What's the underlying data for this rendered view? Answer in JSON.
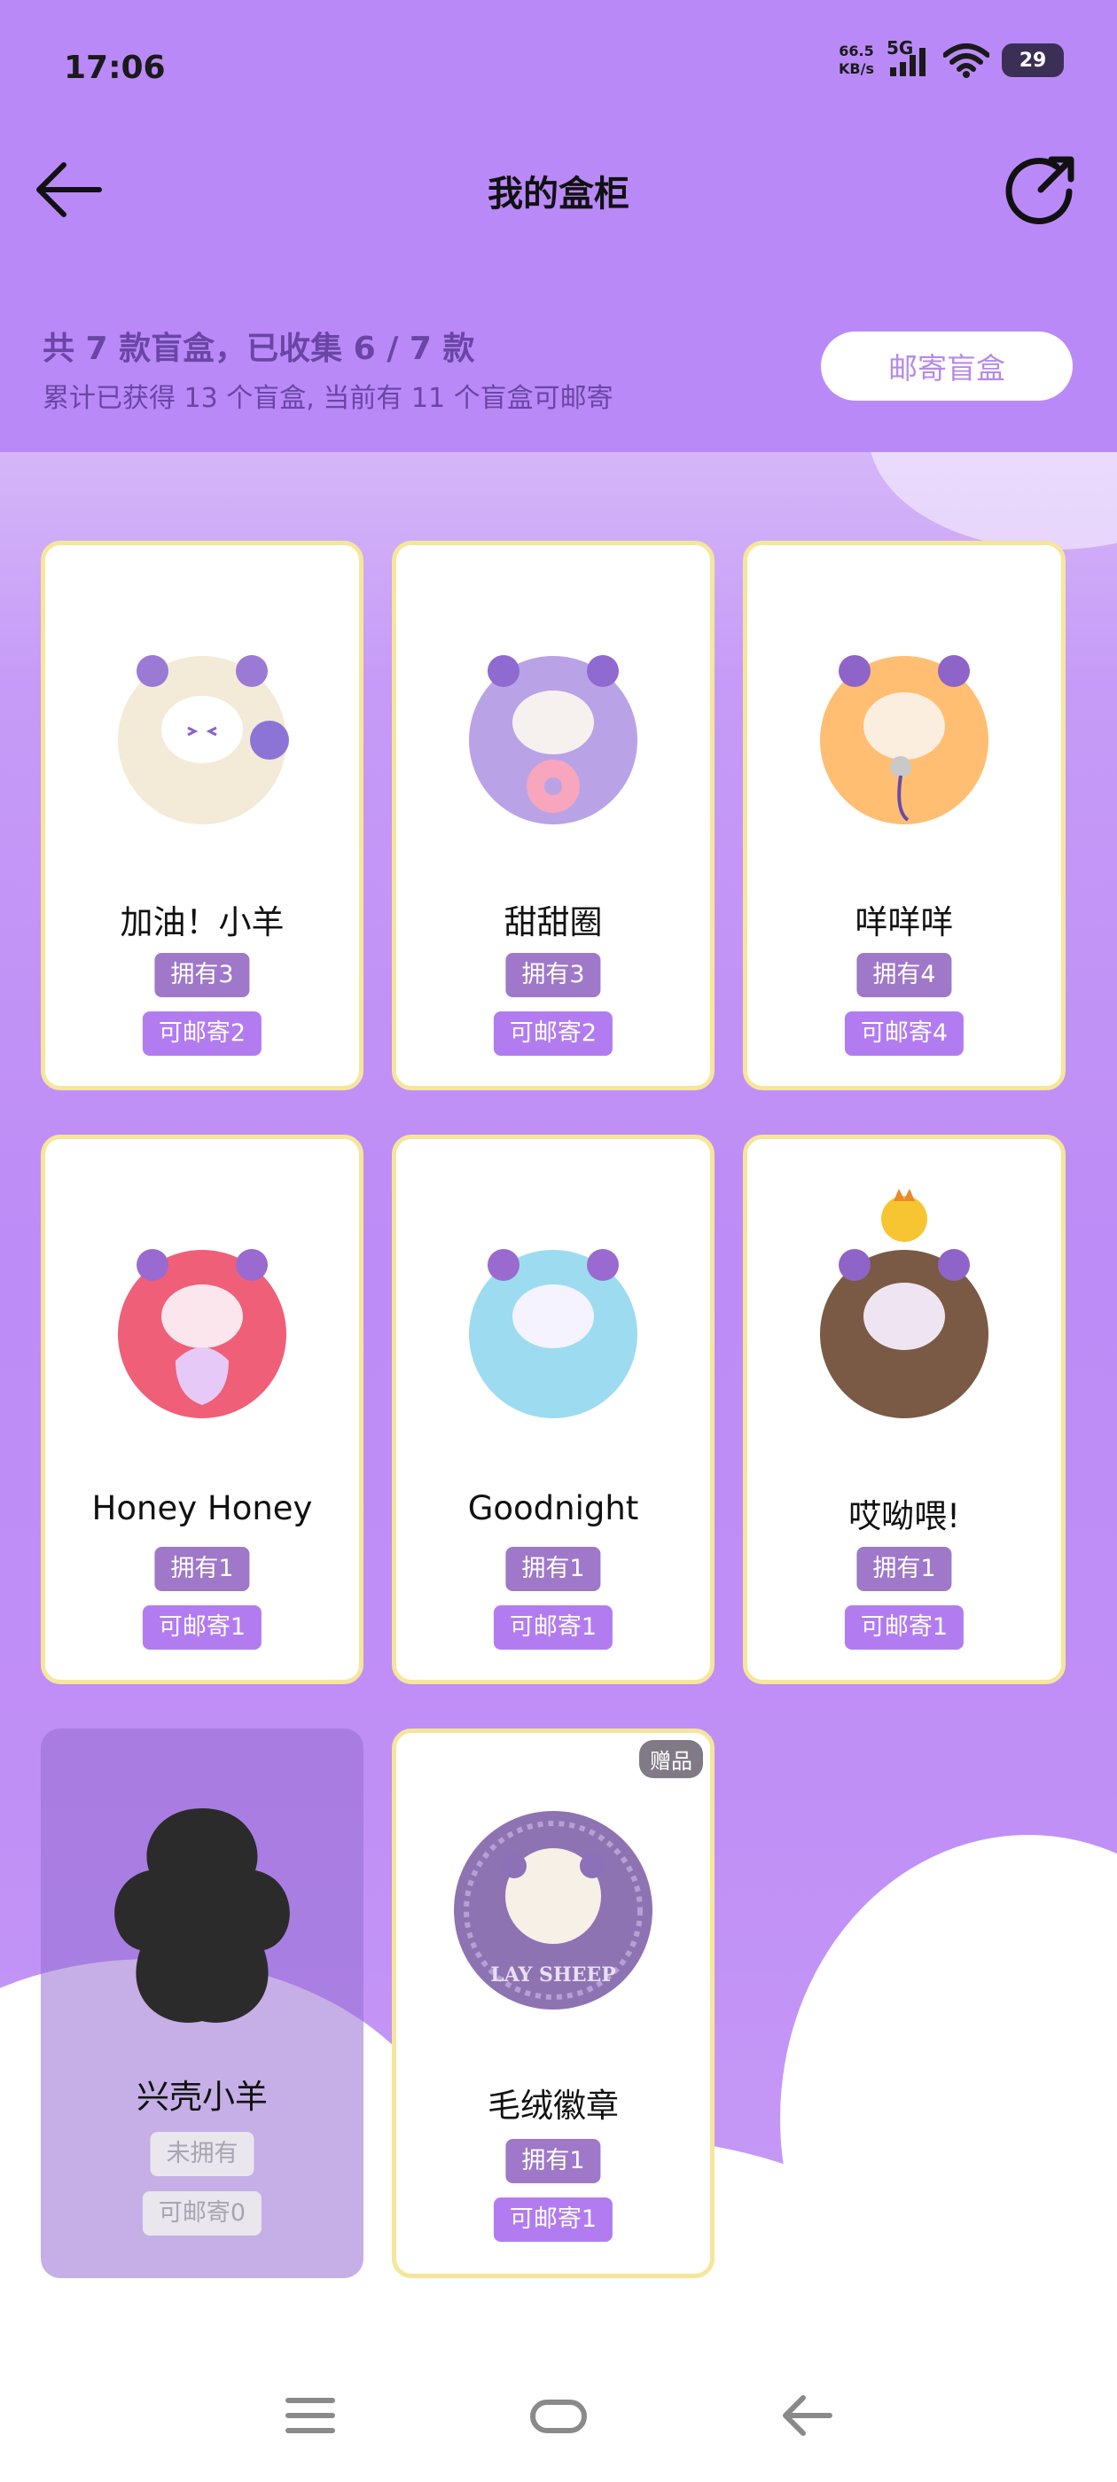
{
  "status": {
    "time": "17:06",
    "netspeed_value": "66.5",
    "netspeed_unit": "KB/s",
    "network": "5G",
    "battery": "29"
  },
  "header": {
    "title": "我的盒柜",
    "back_icon": "arrow-left-icon",
    "share_icon": "share-icon"
  },
  "summary": {
    "line1": "共 7 款盲盒，已收集 6 / 7 款",
    "line2": "累计已获得 13 个盲盒, 当前有 11 个盲盒可邮寄",
    "mail_button": "邮寄盲盒"
  },
  "items": [
    {
      "name": "加油！小羊",
      "own": "拥有3",
      "mail": "可邮寄2",
      "color": "#f3ead8"
    },
    {
      "name": "甜甜圈",
      "own": "拥有3",
      "mail": "可邮寄2",
      "color": "#b9a3e6"
    },
    {
      "name": "咩咩咩",
      "own": "拥有4",
      "mail": "可邮寄4",
      "color": "#ffbe72"
    },
    {
      "name": "Honey Honey",
      "own": "拥有1",
      "mail": "可邮寄1",
      "color": "#ef5f78"
    },
    {
      "name": "Goodnight",
      "own": "拥有1",
      "mail": "可邮寄1",
      "color": "#9ddcf0"
    },
    {
      "name": "哎呦喂!",
      "own": "拥有1",
      "mail": "可邮寄1",
      "color": "#7b5a45"
    },
    {
      "name": "兴壳小羊",
      "own": "未拥有",
      "mail": "可邮寄0",
      "color": "#2b2b2b"
    },
    {
      "name": "毛绒徽章",
      "own": "拥有1",
      "mail": "可邮寄1",
      "color": "#8e73b3",
      "tag": "赠品"
    }
  ],
  "badge_text": "LAY SHEEP",
  "nav": {
    "menu_icon": "menu-icon",
    "home_icon": "home-icon",
    "back_icon": "back-icon"
  }
}
